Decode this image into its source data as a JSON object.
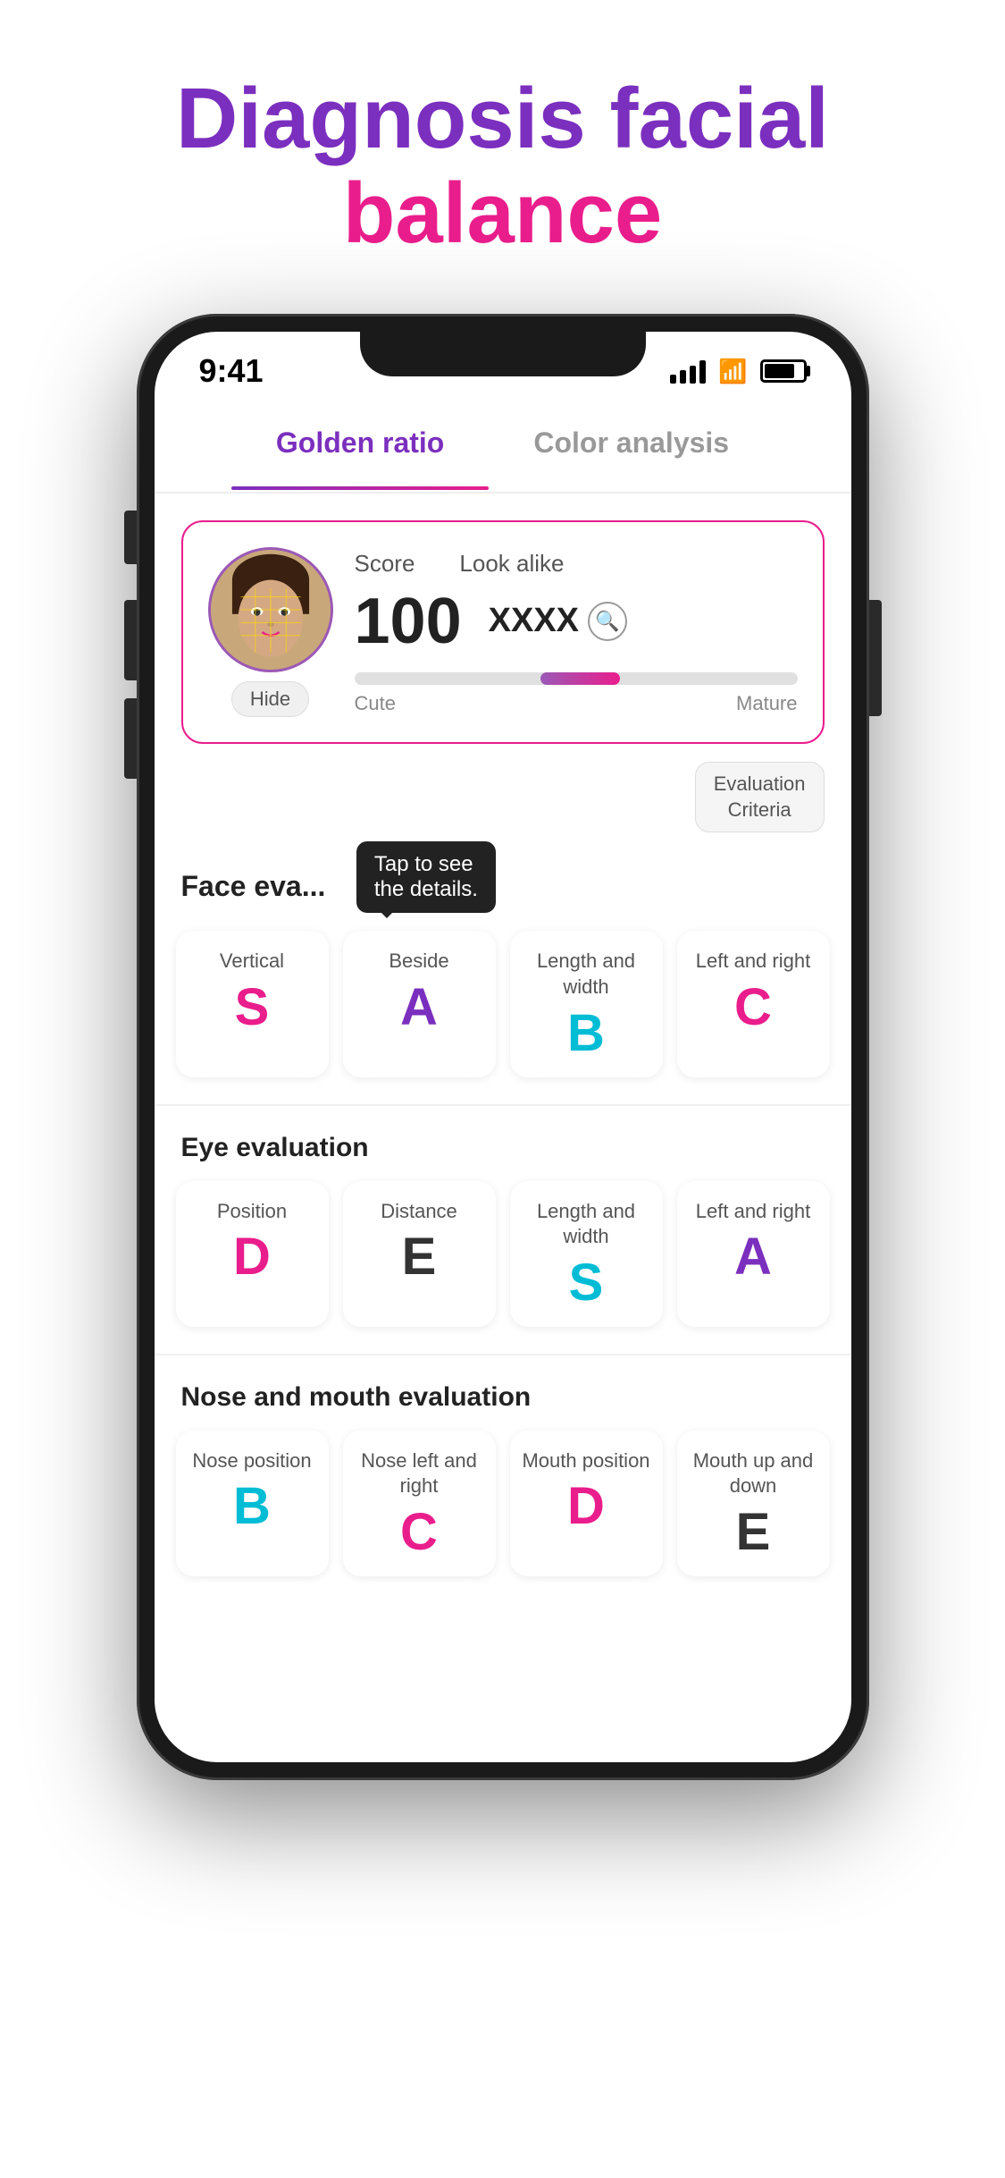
{
  "headline": {
    "line1_purple": "Diagnosis facial",
    "line2_pink": "balance"
  },
  "status_bar": {
    "time": "9:41"
  },
  "tabs": [
    {
      "id": "golden-ratio",
      "label": "Golden ratio",
      "active": true
    },
    {
      "id": "color-analysis",
      "label": "Color analysis",
      "active": false
    }
  ],
  "score_card": {
    "score_label": "Score",
    "look_alike_label": "Look alike",
    "score_value": "100",
    "look_alike_value": "XXXX",
    "hide_button": "Hide",
    "scale_left": "Cute",
    "scale_right": "Mature",
    "evaluation_criteria": "Evaluation\nCriteria"
  },
  "face_evaluation": {
    "title": "Face eva...",
    "tooltip": "Tap to see\nthe details.",
    "cards": [
      {
        "label": "Vertical",
        "grade": "S",
        "color": "grade-pink"
      },
      {
        "label": "Beside",
        "grade": "A",
        "color": "grade-purple"
      },
      {
        "label": "Length and width",
        "grade": "B",
        "color": "grade-cyan"
      },
      {
        "label": "Left and right",
        "grade": "C",
        "color": "grade-pink"
      }
    ]
  },
  "eye_evaluation": {
    "title": "Eye evaluation",
    "cards": [
      {
        "label": "Position",
        "grade": "D",
        "color": "grade-pink"
      },
      {
        "label": "Distance",
        "grade": "E",
        "color": "grade-dark"
      },
      {
        "label": "Length and width",
        "grade": "S",
        "color": "grade-cyan"
      },
      {
        "label": "Left and right",
        "grade": "A",
        "color": "grade-purple"
      }
    ]
  },
  "nose_mouth_evaluation": {
    "title": "Nose and mouth evaluation",
    "cards": [
      {
        "label": "Nose position",
        "grade": "B",
        "color": "grade-cyan"
      },
      {
        "label": "Nose left and right",
        "grade": "C",
        "color": "grade-pink"
      },
      {
        "label": "Mouth position",
        "grade": "D",
        "color": "grade-pink"
      },
      {
        "label": "Mouth up and down",
        "grade": "E",
        "color": "grade-dark"
      }
    ]
  }
}
